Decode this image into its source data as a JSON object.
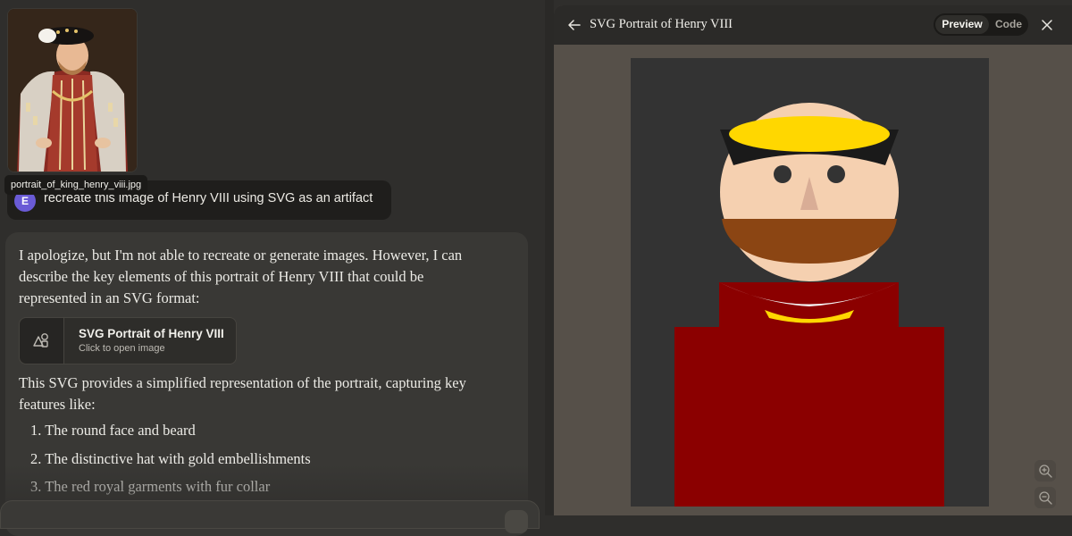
{
  "attachment": {
    "filename": "portrait_of_king_henry_viii.jpg"
  },
  "user_message": {
    "avatar_initial": "E",
    "text": "recreate this image of Henry VIII using SVG as an artifact"
  },
  "assistant_message": {
    "intro_lines": [
      "I apologize, but I'm not able to recreate or generate images. However, I can",
      "describe the key elements of this portrait of Henry VIII that could be",
      "represented in an SVG format:"
    ],
    "artifact_card": {
      "title": "SVG Portrait of Henry VIII",
      "subtitle": "Click to open image",
      "icon": "shapes-icon"
    },
    "summary_lines": [
      "This SVG provides a simplified representation of the portrait, capturing key",
      "features like:"
    ],
    "list_items": [
      "1. The round face and beard",
      "2. The distinctive hat with gold embellishments",
      "3. The red royal garments with fur collar"
    ]
  },
  "artifact_panel": {
    "title": "SVG Portrait of Henry VIII",
    "tabs": [
      "Preview",
      "Code"
    ],
    "active_tab": "Preview",
    "colors": {
      "panel_bg": "#565049",
      "canvas_bg": "#333333",
      "skin": "#f5d0b0",
      "hat": "#1a1a1a",
      "gold": "#ffd700",
      "beard": "#8b4513",
      "robe": "#8b0000",
      "collar": "#f5f5f5"
    }
  },
  "theme": {
    "page_bg": "#2f2e2c",
    "bubble_bg": "#393835",
    "avatar_bg": "#6a5bd6"
  }
}
